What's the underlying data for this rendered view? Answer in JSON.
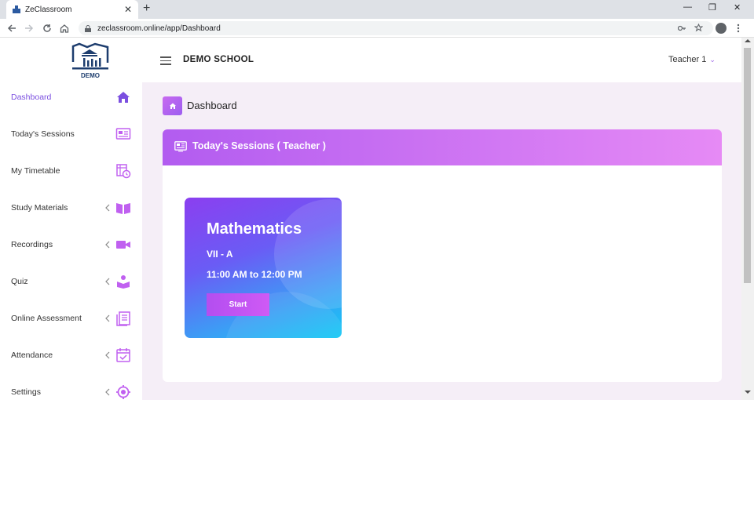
{
  "browser": {
    "tab_title": "ZeClassroom",
    "tab_close": "✕",
    "new_tab": "+",
    "url": "zeclassroom.online/app/Dashboard",
    "window_minimize": "—",
    "window_restore": "❐",
    "window_close": "✕"
  },
  "logo": {
    "text": "DEMO"
  },
  "header": {
    "school_name": "DEMO SCHOOL",
    "user_label": "Teacher 1",
    "user_chevron": "⌄"
  },
  "sidebar": {
    "items": [
      {
        "label": "Dashboard",
        "icon": "home-icon",
        "active": true,
        "has_submenu": false
      },
      {
        "label": "Today's Sessions",
        "icon": "sessions-icon",
        "active": false,
        "has_submenu": false
      },
      {
        "label": "My Timetable",
        "icon": "timetable-icon",
        "active": false,
        "has_submenu": false
      },
      {
        "label": "Study Materials",
        "icon": "book-icon",
        "active": false,
        "has_submenu": true
      },
      {
        "label": "Recordings",
        "icon": "video-icon",
        "active": false,
        "has_submenu": true
      },
      {
        "label": "Quiz",
        "icon": "quiz-icon",
        "active": false,
        "has_submenu": true
      },
      {
        "label": "Online Assessment",
        "icon": "assessment-icon",
        "active": false,
        "has_submenu": true
      },
      {
        "label": "Attendance",
        "icon": "calendar-check-icon",
        "active": false,
        "has_submenu": true
      },
      {
        "label": "Settings",
        "icon": "settings-icon",
        "active": false,
        "has_submenu": true
      }
    ]
  },
  "page": {
    "title": "Dashboard",
    "panel_title": "Today's Sessions ( Teacher )"
  },
  "session_card": {
    "subject": "Mathematics",
    "class_name": "VII - A",
    "time": "11:00 AM to 12:00 PM",
    "start_label": "Start"
  },
  "colors": {
    "accent": "#7b4fe0",
    "icon": "#a855f7",
    "panel_header_start": "#b25cf0",
    "panel_header_end": "#e68af5"
  }
}
